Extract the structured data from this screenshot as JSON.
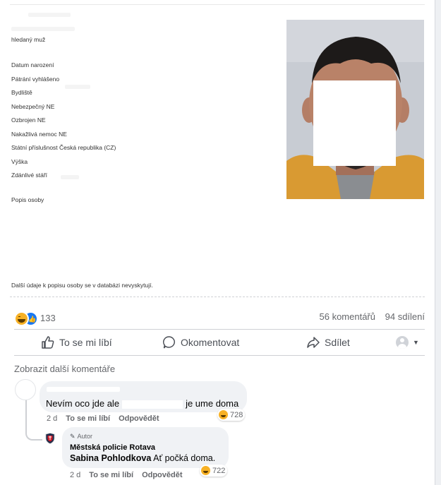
{
  "wanted": {
    "heading": "hledaný muž",
    "fields": [
      "Datum narození",
      "Pátrání vyhlášeno",
      "Bydliště",
      "Nebezpečný NE",
      "Ozbrojen NE",
      "Nakažlivá nemoc NE",
      "Státní příslušnost Česká republika (CZ)",
      "Výška",
      "Zdánlivé stáří"
    ],
    "description_label": "Popis osoby",
    "footer_note": "Další údaje k popisu osoby se v databázi nevyskytují."
  },
  "post_stats": {
    "reaction_count": "133",
    "comments": "56 komentářů",
    "shares": "94 sdílení"
  },
  "actions": {
    "like": "To se mi líbí",
    "comment": "Okomentovat",
    "share": "Sdílet"
  },
  "comments_section": {
    "more_comments": "Zobrazit další komentáře",
    "comment1": {
      "text_before": "Nevím oco jde ale",
      "text_after": "je ume doma",
      "reactions": "728",
      "time": "2 d",
      "like": "To se mi líbí",
      "reply": "Odpovědět"
    },
    "reply1": {
      "author_badge": "Autor",
      "author_name": "Městská policie Rotava",
      "mention": "Sabina Pohlodkova",
      "text": "Ať počká doma.",
      "reactions": "722",
      "time": "2 d",
      "like": "To se mi líbí",
      "reply": "Odpovědět"
    }
  },
  "colors": {
    "accent_blue": "#1877f2",
    "haha_yellow": "#f7b125",
    "secondary_text": "#65676b",
    "bubble_bg": "#f0f2f5"
  }
}
